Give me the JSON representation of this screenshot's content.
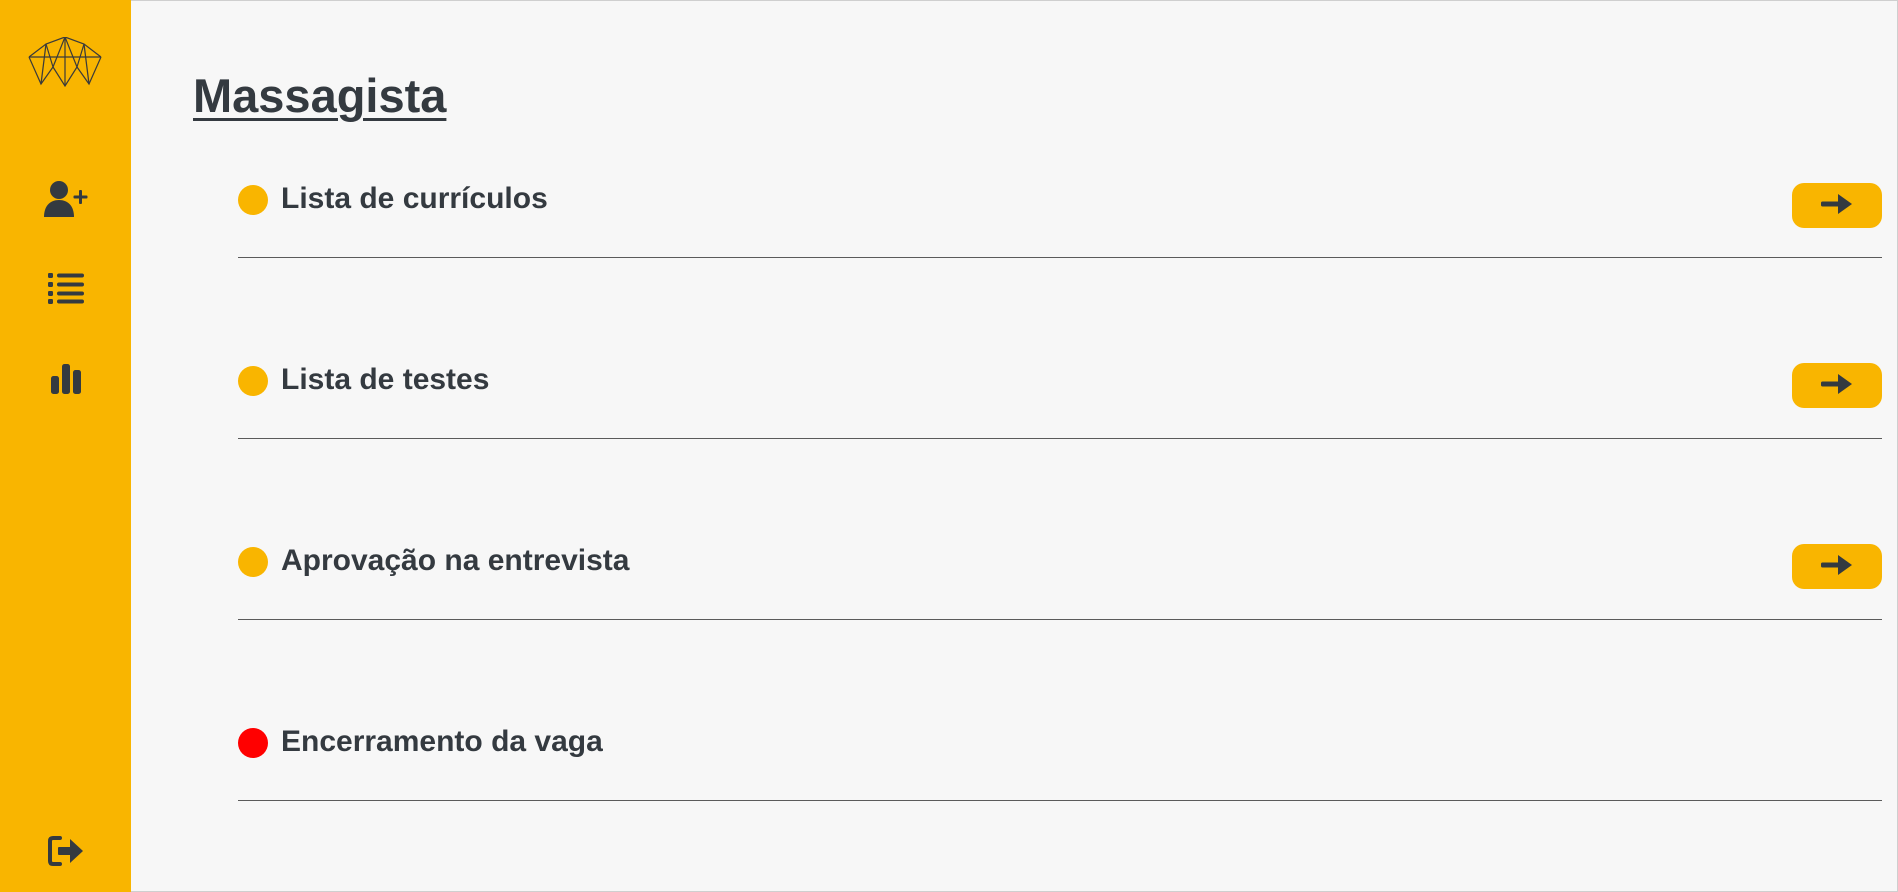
{
  "app": {
    "brand_color": "#f9b500",
    "text_color": "#343a40",
    "logo_icon": "geometric-mountain-logo"
  },
  "sidebar": {
    "items": [
      {
        "name": "add-candidate",
        "icon": "user-plus-icon"
      },
      {
        "name": "list",
        "icon": "list-icon"
      },
      {
        "name": "reports",
        "icon": "bar-chart-icon"
      }
    ],
    "logout": {
      "icon": "sign-out-icon"
    }
  },
  "main": {
    "title": "Massagista",
    "steps": [
      {
        "label": "Lista de currículos",
        "status_color": "#f9b500",
        "action_icon": "arrow-right-icon"
      },
      {
        "label": "Lista de testes",
        "status_color": "#f9b500",
        "action_icon": "arrow-right-icon"
      },
      {
        "label": "Aprovação na entrevista",
        "status_color": "#f9b500",
        "action_icon": "arrow-right-icon"
      },
      {
        "label": "Encerramento da vaga",
        "status_color": "#ff0000"
      }
    ]
  }
}
